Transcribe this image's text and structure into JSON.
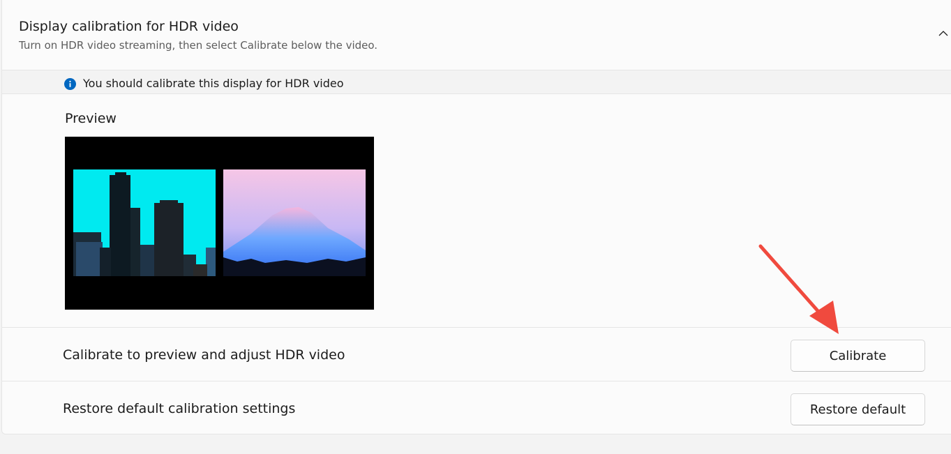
{
  "header": {
    "title": "Display calibration for HDR video",
    "subtitle": "Turn on HDR video streaming, then select Calibrate below the video.",
    "chevron_icon": "chevron-up-icon"
  },
  "info_bar": {
    "icon": "info-icon",
    "text": "You should calibrate this display for HDR video",
    "icon_color": "#0067c0"
  },
  "preview": {
    "label": "Preview",
    "images": [
      "city-skyline-thumbnail",
      "mountain-thumbnail"
    ]
  },
  "rows": [
    {
      "label": "Calibrate to preview and adjust HDR video",
      "button_label": "Calibrate"
    },
    {
      "label": "Restore default calibration settings",
      "button_label": "Restore default"
    }
  ],
  "annotation": {
    "icon": "red-arrow-icon",
    "color": "#f04a3e"
  }
}
